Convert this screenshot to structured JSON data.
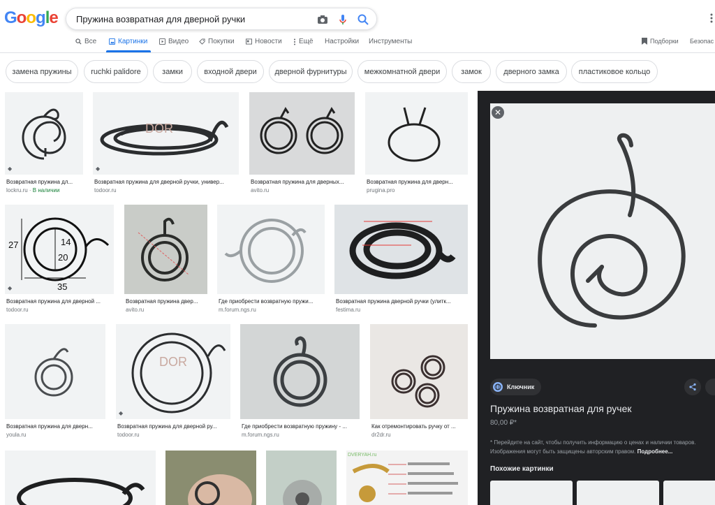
{
  "logo": {
    "text": "Google"
  },
  "search": {
    "query": "Пружина возвратная для дверной ручки"
  },
  "tabs": [
    {
      "label": "Все",
      "icon": "search-icon"
    },
    {
      "label": "Картинки",
      "icon": "image-icon"
    },
    {
      "label": "Видео",
      "icon": "video-icon"
    },
    {
      "label": "Покупки",
      "icon": "tag-icon"
    },
    {
      "label": "Новости",
      "icon": "news-icon"
    },
    {
      "label": "Ещё",
      "icon": "more-vert-icon"
    },
    {
      "label": "Настройки"
    },
    {
      "label": "Инструменты"
    }
  ],
  "header_right": {
    "collections": "Подборки",
    "safesearch": "Безопас"
  },
  "chips": [
    "замена пружины",
    "ruchki palidore",
    "замки",
    "входной двери",
    "дверной фурнитуры",
    "межкомнатной двери",
    "замок",
    "дверного замка",
    "пластиковое кольцо"
  ],
  "results": [
    {
      "caption": "Возвратная пружина дл...",
      "source": "lockru.ru",
      "badge": "В наличии"
    },
    {
      "caption": "Возвратная пружина для дверной ручки, универ...",
      "source": "todoor.ru"
    },
    {
      "caption": "Возвратная пружина для дверных...",
      "source": "avito.ru"
    },
    {
      "caption": "Возвратная пружина для дверн...",
      "source": "prugina.pro"
    },
    {
      "caption": "Возвратная пружина для дверной ...",
      "source": "todoor.ru"
    },
    {
      "caption": "Возвратная пружина двер...",
      "source": "avito.ru"
    },
    {
      "caption": "Где приобрести возвратную пружи...",
      "source": "m.forum.ngs.ru"
    },
    {
      "caption": "Возвратная пружина дверной ручки (улитк...",
      "source": "festima.ru"
    },
    {
      "caption": "Возвратная пружина для дверн...",
      "source": "youla.ru"
    },
    {
      "caption": "Возвратная пружина для дверной ру...",
      "source": "todoor.ru"
    },
    {
      "caption": "Где приобрести возвратную пружину - ...",
      "source": "m.forum.ngs.ru"
    },
    {
      "caption": "Как отремонтировать ручку от ...",
      "source": "dr2dr.ru"
    }
  ],
  "panel": {
    "site": "Ключник",
    "title": "Пружина возвратная для ручек",
    "price": "80,00 ₽*",
    "note": "* Перейдите на сайт, чтобы получить информацию о ценах и наличии товаров. Изображения могут быть защищены авторским правом.",
    "more": "Подробнее...",
    "similar": "Похожие картинки",
    "close": "✕"
  },
  "image_labels": {
    "dim_27": "27",
    "dim_14": "14",
    "dim_20": "20",
    "dim_35": "35",
    "overlay_brand": "DOR",
    "bottom_brand": "DVERYAH.ru"
  },
  "colors": {
    "accent": "#1a73e8",
    "panel_bg": "#202124",
    "spring": "#2b2d2f"
  }
}
